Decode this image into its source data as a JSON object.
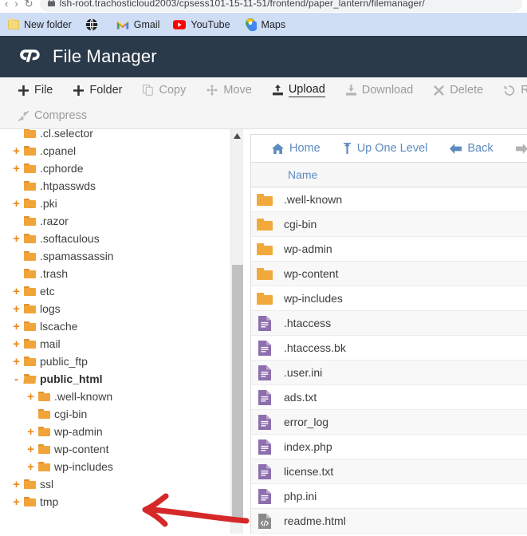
{
  "browser": {
    "url": "lsh-root.trachosticloud2003/cpsess101-15-11-51/frontend/paper_lantern/filemanager/",
    "nav_back_icon": "back-arrow-icon",
    "nav_forward_icon": "forward-arrow-icon",
    "nav_reload_icon": "reload-icon",
    "lock_icon": "lock-icon",
    "bookmarks": [
      {
        "label": "New folder",
        "icon": "folder-icon"
      },
      {
        "label": "",
        "icon": "globe-icon"
      },
      {
        "label": "Gmail",
        "icon": "gmail-icon"
      },
      {
        "label": "YouTube",
        "icon": "youtube-icon"
      },
      {
        "label": "Maps",
        "icon": "maps-icon"
      }
    ]
  },
  "header": {
    "title": "File Manager",
    "logo_icon": "cpanel-logo-icon",
    "bg_color": "#2b3a4a"
  },
  "toolbar": {
    "row1": [
      {
        "label": "File",
        "icon": "plus-icon",
        "state": "enabled"
      },
      {
        "label": "Folder",
        "icon": "plus-icon",
        "state": "enabled"
      },
      {
        "label": "Copy",
        "icon": "copy-icon",
        "state": "disabled"
      },
      {
        "label": "Move",
        "icon": "move-icon",
        "state": "disabled"
      },
      {
        "label": "Upload",
        "icon": "upload-icon",
        "state": "active"
      },
      {
        "label": "Download",
        "icon": "download-icon",
        "state": "disabled"
      },
      {
        "label": "Delete",
        "icon": "delete-icon",
        "state": "disabled"
      },
      {
        "label": "Restore",
        "icon": "restore-icon",
        "state": "disabled"
      }
    ],
    "row2": [
      {
        "label": "Compress",
        "icon": "compress-icon",
        "state": "disabled"
      }
    ]
  },
  "tree": {
    "nodes": [
      {
        "label": ".cl.selector",
        "indent": 1,
        "expander": "",
        "icon": "folder-icon"
      },
      {
        "label": ".cpanel",
        "indent": 1,
        "expander": "+",
        "icon": "folder-icon"
      },
      {
        "label": ".cphorde",
        "indent": 1,
        "expander": "+",
        "icon": "folder-icon"
      },
      {
        "label": ".htpasswds",
        "indent": 1,
        "expander": "",
        "icon": "folder-icon"
      },
      {
        "label": ".pki",
        "indent": 1,
        "expander": "+",
        "icon": "folder-icon"
      },
      {
        "label": ".razor",
        "indent": 1,
        "expander": "",
        "icon": "folder-icon"
      },
      {
        "label": ".softaculous",
        "indent": 1,
        "expander": "+",
        "icon": "folder-icon"
      },
      {
        "label": ".spamassassin",
        "indent": 1,
        "expander": "",
        "icon": "folder-icon"
      },
      {
        "label": ".trash",
        "indent": 1,
        "expander": "",
        "icon": "folder-icon"
      },
      {
        "label": "etc",
        "indent": 1,
        "expander": "+",
        "icon": "folder-icon"
      },
      {
        "label": "logs",
        "indent": 1,
        "expander": "+",
        "icon": "folder-icon"
      },
      {
        "label": "lscache",
        "indent": 1,
        "expander": "+",
        "icon": "folder-icon"
      },
      {
        "label": "mail",
        "indent": 1,
        "expander": "+",
        "icon": "folder-icon"
      },
      {
        "label": "public_ftp",
        "indent": 1,
        "expander": "+",
        "icon": "folder-icon"
      },
      {
        "label": "public_html",
        "indent": 1,
        "expander": "-",
        "icon": "folder-open-icon",
        "selected": true
      },
      {
        "label": ".well-known",
        "indent": 2,
        "expander": "+",
        "icon": "folder-icon"
      },
      {
        "label": "cgi-bin",
        "indent": 2,
        "expander": "",
        "icon": "folder-icon"
      },
      {
        "label": "wp-admin",
        "indent": 2,
        "expander": "+",
        "icon": "folder-icon"
      },
      {
        "label": "wp-content",
        "indent": 2,
        "expander": "+",
        "icon": "folder-icon"
      },
      {
        "label": "wp-includes",
        "indent": 2,
        "expander": "+",
        "icon": "folder-icon"
      },
      {
        "label": "ssl",
        "indent": 1,
        "expander": "+",
        "icon": "folder-icon"
      },
      {
        "label": "tmp",
        "indent": 1,
        "expander": "+",
        "icon": "folder-icon"
      }
    ],
    "scrollbar": {
      "up_arrow_icon": "scroll-up-icon"
    }
  },
  "filelist": {
    "nav": [
      {
        "label": "Home",
        "icon": "home-icon",
        "state": "enabled"
      },
      {
        "label": "Up One Level",
        "icon": "up-level-icon",
        "state": "enabled"
      },
      {
        "label": "Back",
        "icon": "back-icon",
        "state": "enabled"
      },
      {
        "label": "Forward",
        "icon": "forward-icon",
        "state": "disabled"
      }
    ],
    "columns": [
      "Name"
    ],
    "rows": [
      {
        "name": ".well-known",
        "type": "folder"
      },
      {
        "name": "cgi-bin",
        "type": "folder"
      },
      {
        "name": "wp-admin",
        "type": "folder"
      },
      {
        "name": "wp-content",
        "type": "folder"
      },
      {
        "name": "wp-includes",
        "type": "folder"
      },
      {
        "name": ".htaccess",
        "type": "file"
      },
      {
        "name": ".htaccess.bk",
        "type": "file"
      },
      {
        "name": ".user.ini",
        "type": "file"
      },
      {
        "name": "ads.txt",
        "type": "file"
      },
      {
        "name": "error_log",
        "type": "file"
      },
      {
        "name": "index.php",
        "type": "file"
      },
      {
        "name": "license.txt",
        "type": "file"
      },
      {
        "name": "php.ini",
        "type": "file"
      },
      {
        "name": "readme.html",
        "type": "html"
      }
    ]
  },
  "annotation": {
    "type": "red-arrow",
    "points_to": "public_html",
    "color": "#d62828"
  }
}
